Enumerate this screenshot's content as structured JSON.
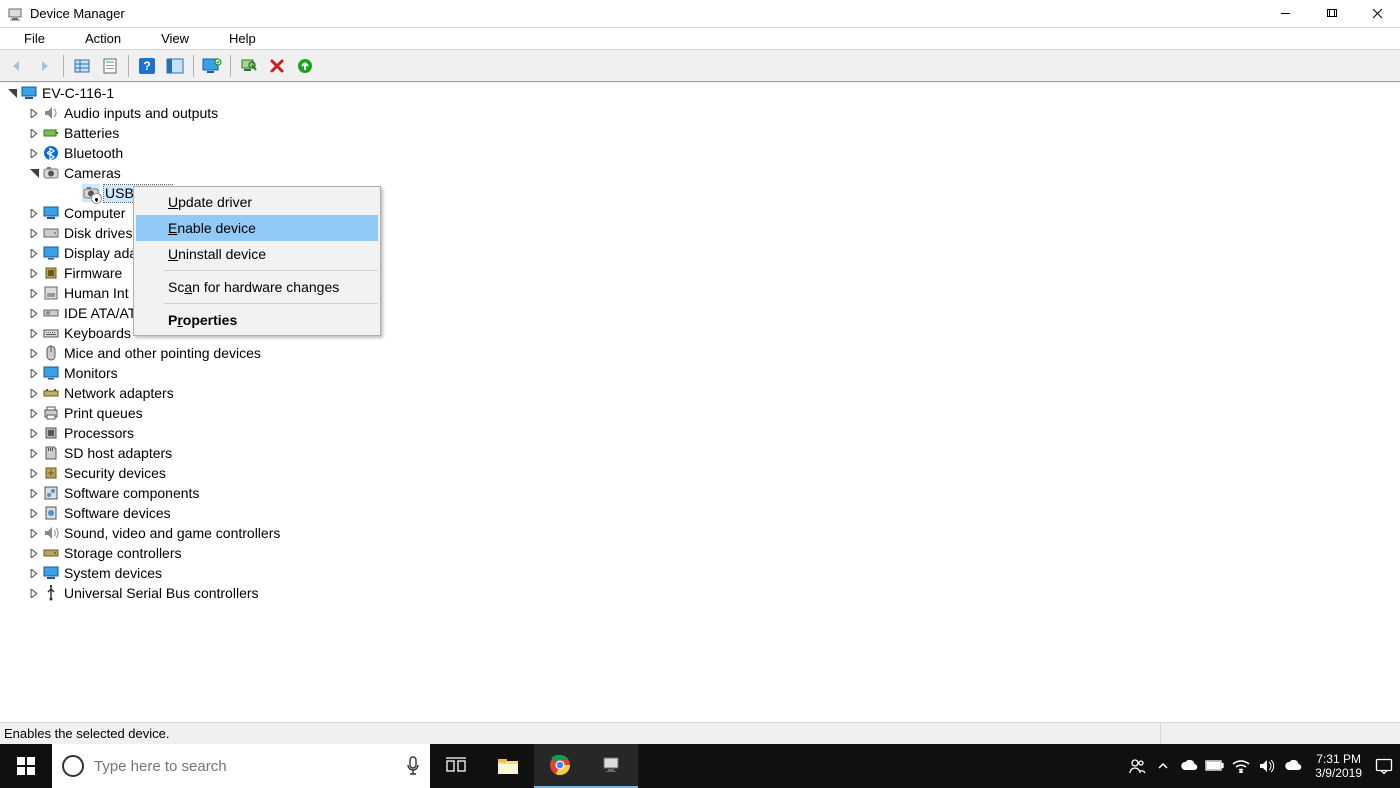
{
  "window": {
    "title": "Device Manager"
  },
  "menubar": [
    "File",
    "Action",
    "View",
    "Help"
  ],
  "toolbar": [
    {
      "name": "nav-back",
      "kind": "arrow-left",
      "disabled": true
    },
    {
      "name": "nav-forward",
      "kind": "arrow-right",
      "disabled": true
    },
    {
      "name": "sep"
    },
    {
      "name": "show-hidden",
      "kind": "grid"
    },
    {
      "name": "properties",
      "kind": "props"
    },
    {
      "name": "sep"
    },
    {
      "name": "help",
      "kind": "help"
    },
    {
      "name": "action-center",
      "kind": "pane"
    },
    {
      "name": "sep"
    },
    {
      "name": "update-driver",
      "kind": "monitor"
    },
    {
      "name": "sep"
    },
    {
      "name": "scan-hardware",
      "kind": "scan"
    },
    {
      "name": "uninstall",
      "kind": "uninstall"
    },
    {
      "name": "enable",
      "kind": "enable"
    }
  ],
  "tree": {
    "root": {
      "label": "EV-C-116-1",
      "icon": "computer",
      "expanded": true
    },
    "children": [
      {
        "label": "Audio inputs and outputs",
        "icon": "audio"
      },
      {
        "label": "Batteries",
        "icon": "battery"
      },
      {
        "label": "Bluetooth",
        "icon": "bluetooth"
      },
      {
        "label": "Cameras",
        "icon": "camera",
        "expanded": true,
        "children": [
          {
            "label": "USB Æ¾▯",
            "icon": "camera",
            "selected": true,
            "disabled": true
          }
        ]
      },
      {
        "label": "Computer",
        "icon": "computer",
        "truncated": true
      },
      {
        "label": "Disk drives",
        "icon": "disk"
      },
      {
        "label": "Display adapters",
        "icon": "display",
        "truncated": true
      },
      {
        "label": "Firmware",
        "icon": "chip"
      },
      {
        "label": "Human Interface Devices",
        "icon": "hid",
        "truncated": true,
        "displayed": "Human Int"
      },
      {
        "label": "IDE ATA/ATAPI controllers",
        "icon": "ide",
        "truncated": true,
        "displayed": "IDE ATA/AT"
      },
      {
        "label": "Keyboards",
        "icon": "keyboard"
      },
      {
        "label": "Mice and other pointing devices",
        "icon": "mouse"
      },
      {
        "label": "Monitors",
        "icon": "monitor"
      },
      {
        "label": "Network adapters",
        "icon": "network"
      },
      {
        "label": "Print queues",
        "icon": "printer"
      },
      {
        "label": "Processors",
        "icon": "cpu"
      },
      {
        "label": "SD host adapters",
        "icon": "sd"
      },
      {
        "label": "Security devices",
        "icon": "security"
      },
      {
        "label": "Software components",
        "icon": "swcomp"
      },
      {
        "label": "Software devices",
        "icon": "swdev"
      },
      {
        "label": "Sound, video and game controllers",
        "icon": "sound"
      },
      {
        "label": "Storage controllers",
        "icon": "storage"
      },
      {
        "label": "System devices",
        "icon": "system"
      },
      {
        "label": "Universal Serial Bus controllers",
        "icon": "usb"
      }
    ]
  },
  "context_menu": {
    "items": [
      {
        "label": "Update driver",
        "mnemonic": 0
      },
      {
        "label": "Enable device",
        "mnemonic": 0,
        "hover": true
      },
      {
        "label": "Uninstall device",
        "mnemonic": 0
      },
      {
        "sep": true
      },
      {
        "label": "Scan for hardware changes",
        "mnemonic": 2
      },
      {
        "sep": true
      },
      {
        "label": "Properties",
        "mnemonic": 1,
        "bold": true
      }
    ]
  },
  "statusbar": {
    "text": "Enables the selected device."
  },
  "taskbar": {
    "search_placeholder": "Type here to search",
    "time": "7:31 PM",
    "date": "3/9/2019",
    "apps": [
      {
        "name": "task-view",
        "icon": "taskview"
      },
      {
        "name": "file-explorer",
        "icon": "explorer"
      },
      {
        "name": "chrome",
        "icon": "chrome",
        "active": true
      },
      {
        "name": "device-manager",
        "icon": "devmgr",
        "active": true
      }
    ],
    "tray": [
      {
        "name": "people",
        "icon": "people"
      },
      {
        "name": "overflow",
        "icon": "chevron-up"
      },
      {
        "name": "onedrive",
        "icon": "cloud"
      },
      {
        "name": "battery",
        "icon": "battery"
      },
      {
        "name": "wifi",
        "icon": "wifi"
      },
      {
        "name": "volume",
        "icon": "volume"
      },
      {
        "name": "cloud2",
        "icon": "cloud"
      }
    ]
  }
}
